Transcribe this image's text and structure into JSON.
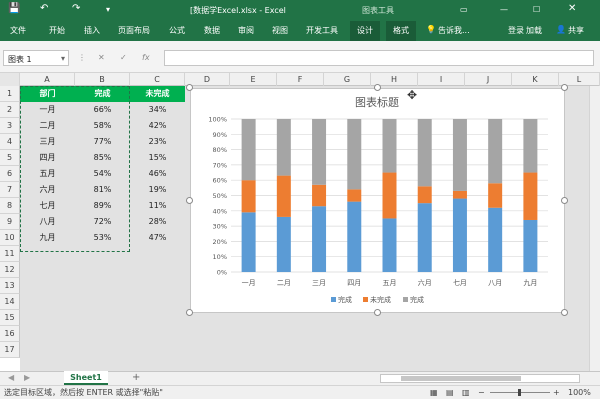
{
  "window": {
    "title": "[数据学Excel.xlsx - Excel",
    "context_title": "图表工具",
    "signin": "登录",
    "share": "共享"
  },
  "ribbon": {
    "tabs": [
      "文件",
      "开始",
      "插入",
      "页面布局",
      "公式",
      "数据",
      "审阅",
      "视图",
      "开发工具",
      "设计",
      "格式"
    ],
    "tellme": "告诉我...",
    "addin": "加载"
  },
  "formula_bar": {
    "name_box": "图表 1",
    "fx": "fx"
  },
  "columns": [
    "A",
    "B",
    "C",
    "D",
    "E",
    "F",
    "G",
    "H",
    "I",
    "J",
    "K",
    "L"
  ],
  "rows": [
    "1",
    "2",
    "3",
    "4",
    "5",
    "6",
    "7",
    "8",
    "9",
    "10",
    "11",
    "12",
    "13",
    "14",
    "15",
    "16",
    "17"
  ],
  "table": {
    "headers": [
      "部门",
      "完成",
      "未完成"
    ],
    "rows": [
      [
        "一月",
        "66%",
        "34%"
      ],
      [
        "二月",
        "58%",
        "42%"
      ],
      [
        "三月",
        "77%",
        "23%"
      ],
      [
        "四月",
        "85%",
        "15%"
      ],
      [
        "五月",
        "54%",
        "46%"
      ],
      [
        "六月",
        "81%",
        "19%"
      ],
      [
        "七月",
        "89%",
        "11%"
      ],
      [
        "八月",
        "72%",
        "28%"
      ],
      [
        "九月",
        "53%",
        "47%"
      ]
    ]
  },
  "chart_data": {
    "type": "bar",
    "title": "图表标题",
    "categories": [
      "一月",
      "二月",
      "三月",
      "四月",
      "五月",
      "六月",
      "七月",
      "八月",
      "九月"
    ],
    "series": [
      {
        "name": "完成",
        "values": [
          39,
          36,
          43,
          46,
          35,
          45,
          48,
          42,
          34
        ]
      },
      {
        "name": "未完成",
        "values": [
          21,
          27,
          14,
          8,
          30,
          11,
          5,
          16,
          31
        ]
      },
      {
        "name": "完成",
        "values": [
          40,
          37,
          43,
          46,
          35,
          44,
          47,
          42,
          35
        ]
      }
    ],
    "stacked": true,
    "ylim": [
      0,
      100
    ],
    "yticks": [
      "0%",
      "10%",
      "20%",
      "30%",
      "40%",
      "50%",
      "60%",
      "70%",
      "80%",
      "90%",
      "100%"
    ],
    "colors": [
      "#5b9bd5",
      "#ed7d31",
      "#a5a5a5"
    ],
    "legend": "bottom",
    "grid": true
  },
  "sheet": {
    "name": "Sheet1",
    "add": "+"
  },
  "status": {
    "message": "选定目标区域，然后按 ENTER 或选择\"粘贴\"",
    "zoom": "100%"
  }
}
